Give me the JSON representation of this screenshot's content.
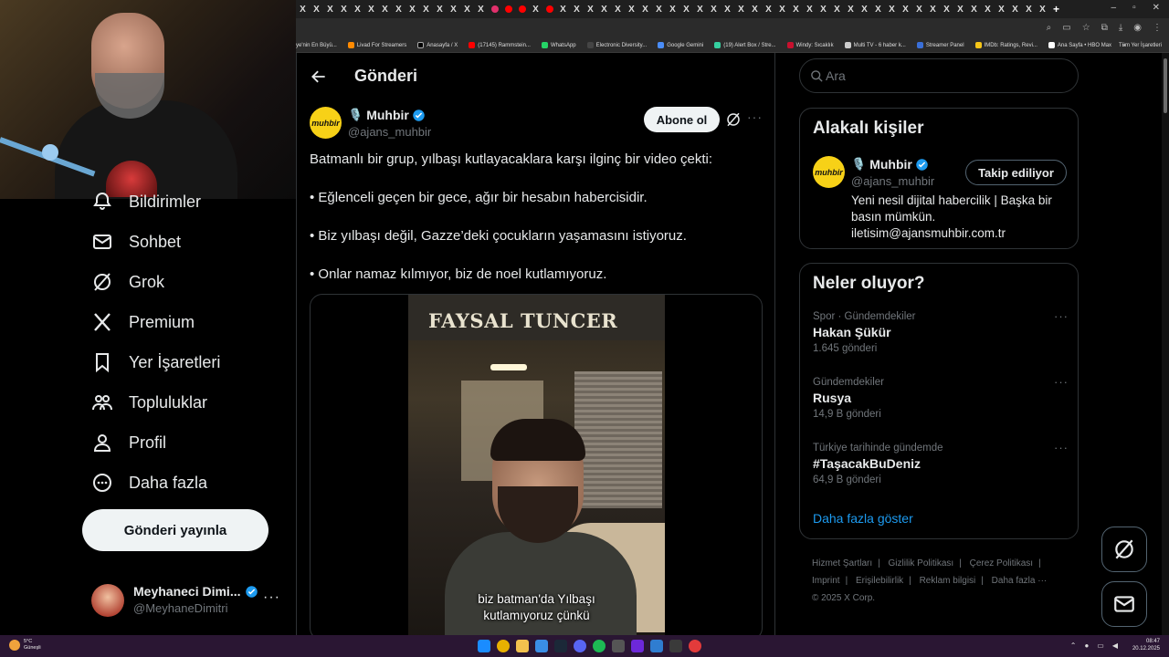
{
  "browser": {
    "bookmarks": [
      "ye'nin En Büyü...",
      "Livad For Streamers",
      "Anasayfa / X",
      "(17145) Rammstein...",
      "WhatsApp",
      "Electronic Diversity...",
      "Google Gemini",
      "(19) Alert Box / Stre...",
      "Windy: Sıcaklık",
      "Multi TV - 6 haber k...",
      "Streamer Panel",
      "IMDb: Ratings, Revi...",
      "Ana Sayfa • HBO Max"
    ],
    "bookmarks_overflow": "»",
    "all_bookmarks": "Tüm Yer İşaretleri",
    "window_controls": [
      "–",
      "▫",
      "✕"
    ]
  },
  "sidebar": {
    "items": [
      {
        "label": "Bildirimler",
        "icon": "bell-icon"
      },
      {
        "label": "Sohbet",
        "icon": "mail-icon"
      },
      {
        "label": "Grok",
        "icon": "grok-icon"
      },
      {
        "label": "Premium",
        "icon": "x-logo-icon"
      },
      {
        "label": "Yer İşaretleri",
        "icon": "bookmark-icon"
      },
      {
        "label": "Topluluklar",
        "icon": "communities-icon"
      },
      {
        "label": "Profil",
        "icon": "profile-icon"
      },
      {
        "label": "Daha fazla",
        "icon": "more-circle-icon"
      }
    ],
    "post_button": "Gönderi yayınla",
    "account": {
      "name": "Meyhaneci Dimi...",
      "handle": "@MeyhaneDimitri",
      "more": "···"
    }
  },
  "post": {
    "header_title": "Gönderi",
    "author": {
      "name": "Muhbir",
      "handle": "@ajans_muhbir",
      "avatar_text": "muhbir",
      "emoji": "🎙️"
    },
    "subscribe_label": "Abone ol",
    "more": "···",
    "text_lines": [
      "Batmanlı bir grup, yılbaşı kutlayacaklara karşı ilginç bir video çekti:",
      "• Eğlenceli geçen bir gece, ağır bir hesabın habercisidir.",
      "• Biz yılbaşı değil, Gazze’deki çocukların yaşamasını istiyoruz.",
      "• Onlar namaz kılmıyor, biz de noel kutlamıyoruz."
    ],
    "video": {
      "sign_text": "FAYSAL TUNCER",
      "caption_line1": "biz batman'da Yılbaşı",
      "caption_line2": "kutlamıyoruz çünkü"
    }
  },
  "search": {
    "placeholder": "Ara"
  },
  "related": {
    "title": "Alakalı kişiler",
    "name": "Muhbir",
    "emoji": "🎙️",
    "handle": "@ajans_muhbir",
    "avatar_text": "muhbir",
    "follow_label": "Takip ediliyor",
    "bio_line1": "Yeni nesil dijital habercilik | Başka bir",
    "bio_line2": "basın mümkün.",
    "bio_line3": "iletisim@ajansmuhbir.com.tr"
  },
  "trends": {
    "title": "Neler oluyor?",
    "items": [
      {
        "context": "Spor · Gündemdekiler",
        "name": "Hakan Şükür",
        "count": "1.645 gönderi"
      },
      {
        "context": "Gündemdekiler",
        "name": "Rusya",
        "count": "14,9 B gönderi"
      },
      {
        "context": "Türkiye tarihinde gündemde",
        "name": "#TaşacakBuDeniz",
        "count": "64,9 B gönderi"
      }
    ],
    "more_dots": "···",
    "show_more": "Daha fazla göster"
  },
  "footer": {
    "links": [
      "Hizmet Şartları",
      "Gizlilik Politikası",
      "Çerez Politikası",
      "Imprint",
      "Erişilebilirlik",
      "Reklam bilgisi",
      "Daha fazla ···"
    ],
    "copyright": "© 2025 X Corp."
  },
  "taskbar": {
    "weather_temp": "5°C",
    "weather_desc": "Güneşli",
    "time": "08:47",
    "date": "20.12.2025"
  },
  "colors": {
    "accent_blue": "#1d9bf0",
    "brand_yellow": "#f7d117",
    "border": "#2f3336",
    "muted_text": "#71767b"
  }
}
